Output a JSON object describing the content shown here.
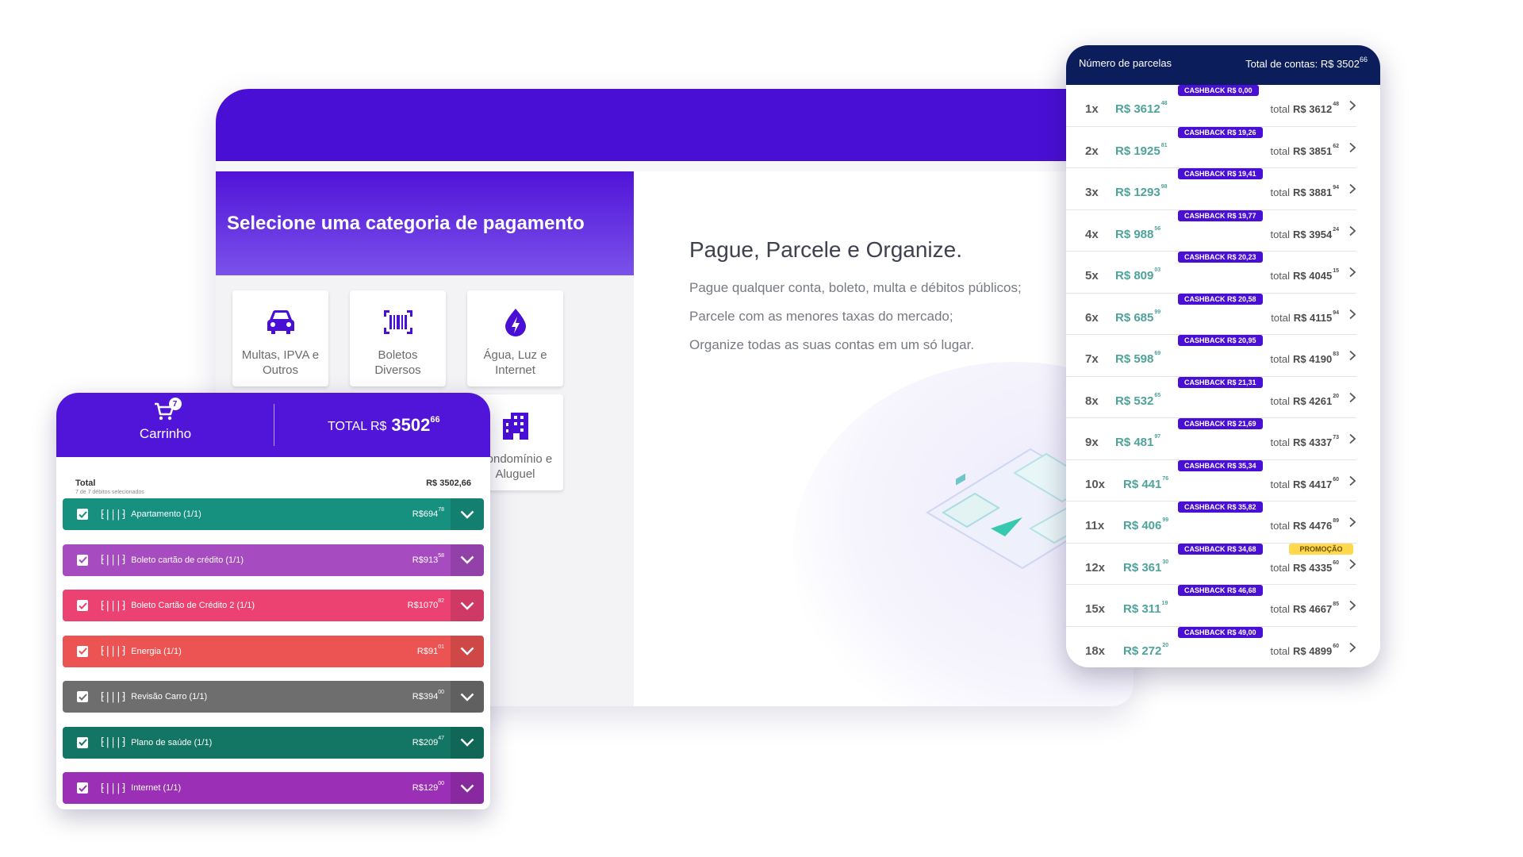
{
  "app": {
    "category_title": "Selecione uma categoria de pagamento",
    "categories": [
      {
        "icon": "car-icon",
        "label": "Multas, IPVA e Outros"
      },
      {
        "icon": "barcode-icon",
        "label": "Boletos Diversos"
      },
      {
        "icon": "water-electricity-icon",
        "label": "Água, Luz e Internet"
      },
      {
        "icon": "building-icon",
        "label": "Condomínio e Aluguel"
      }
    ],
    "hero_title": "Pague, Parcele e Organize.",
    "hero_lines": [
      "Pague qualquer conta, boleto, multa e débitos públicos;",
      "Parcele com as menores taxas do mercado;",
      "Organize todas as suas contas em um só lugar."
    ]
  },
  "cart": {
    "title": "Carrinho",
    "badge": "7",
    "total_label": "TOTAL R$",
    "total_int": "3502",
    "total_cents": "66",
    "summary_label": "Total",
    "summary_sub": "7 de 7 débitos selecionados",
    "summary_value": "R$ 3502,66",
    "items": [
      {
        "name": "Apartamento (1/1)",
        "amount": "R$694",
        "cents": "78",
        "color": "#16917f"
      },
      {
        "name": "Boleto cartão de crédito (1/1)",
        "amount": "R$913",
        "cents": "58",
        "color": "#a74bc0"
      },
      {
        "name": "Boleto Cartão de Crédito 2 (1/1)",
        "amount": "R$1070",
        "cents": "82",
        "color": "#ec4272"
      },
      {
        "name": "Energia (1/1)",
        "amount": "R$91",
        "cents": "01",
        "color": "#ec5353"
      },
      {
        "name": "Revisão Carro (1/1)",
        "amount": "R$394",
        "cents": "00",
        "color": "#6e6e6e"
      },
      {
        "name": "Plano de saúde (1/1)",
        "amount": "R$209",
        "cents": "47",
        "color": "#137563"
      },
      {
        "name": "Internet (1/1)",
        "amount": "R$129",
        "cents": "00",
        "color": "#9b2fb5"
      }
    ]
  },
  "installments": {
    "header_left": "Número de parcelas",
    "header_right": "Total de contas: R$ 3502",
    "header_right_cents": "66",
    "total_prefix": "total",
    "rows": [
      {
        "n": "1x",
        "value": "R$ 3612",
        "vc": "48",
        "cashback": "CASHBACK R$ 0,00",
        "total": "R$ 3612",
        "tc": "48",
        "promo": ""
      },
      {
        "n": "2x",
        "value": "R$ 1925",
        "vc": "81",
        "cashback": "CASHBACK R$ 19,26",
        "total": "R$ 3851",
        "tc": "62",
        "promo": ""
      },
      {
        "n": "3x",
        "value": "R$ 1293",
        "vc": "98",
        "cashback": "CASHBACK R$ 19,41",
        "total": "R$ 3881",
        "tc": "94",
        "promo": ""
      },
      {
        "n": "4x",
        "value": "R$ 988",
        "vc": "56",
        "cashback": "CASHBACK R$ 19,77",
        "total": "R$ 3954",
        "tc": "24",
        "promo": ""
      },
      {
        "n": "5x",
        "value": "R$ 809",
        "vc": "03",
        "cashback": "CASHBACK R$ 20,23",
        "total": "R$ 4045",
        "tc": "15",
        "promo": ""
      },
      {
        "n": "6x",
        "value": "R$ 685",
        "vc": "99",
        "cashback": "CASHBACK R$ 20,58",
        "total": "R$ 4115",
        "tc": "94",
        "promo": ""
      },
      {
        "n": "7x",
        "value": "R$ 598",
        "vc": "69",
        "cashback": "CASHBACK R$ 20,95",
        "total": "R$ 4190",
        "tc": "83",
        "promo": ""
      },
      {
        "n": "8x",
        "value": "R$ 532",
        "vc": "65",
        "cashback": "CASHBACK R$ 21,31",
        "total": "R$ 4261",
        "tc": "20",
        "promo": ""
      },
      {
        "n": "9x",
        "value": "R$ 481",
        "vc": "97",
        "cashback": "CASHBACK R$ 21,69",
        "total": "R$ 4337",
        "tc": "73",
        "promo": ""
      },
      {
        "n": "10x",
        "value": "R$ 441",
        "vc": "76",
        "cashback": "CASHBACK R$ 35,34",
        "total": "R$ 4417",
        "tc": "60",
        "promo": ""
      },
      {
        "n": "11x",
        "value": "R$ 406",
        "vc": "99",
        "cashback": "CASHBACK R$ 35,82",
        "total": "R$ 4476",
        "tc": "89",
        "promo": ""
      },
      {
        "n": "12x",
        "value": "R$ 361",
        "vc": "30",
        "cashback": "CASHBACK R$ 34,68",
        "total": "R$ 4335",
        "tc": "60",
        "promo": "PROMOÇÃO"
      },
      {
        "n": "15x",
        "value": "R$ 311",
        "vc": "19",
        "cashback": "CASHBACK R$ 46,68",
        "total": "R$ 4667",
        "tc": "85",
        "promo": ""
      },
      {
        "n": "18x",
        "value": "R$ 272",
        "vc": "20",
        "cashback": "CASHBACK R$ 49,00",
        "total": "R$ 4899",
        "tc": "60",
        "promo": ""
      }
    ]
  },
  "colors": {
    "brand_purple": "#4a0fd4",
    "navy": "#0c1d5c",
    "teal_value": "#4ea39a",
    "promo_yellow": "#ffd84d"
  }
}
